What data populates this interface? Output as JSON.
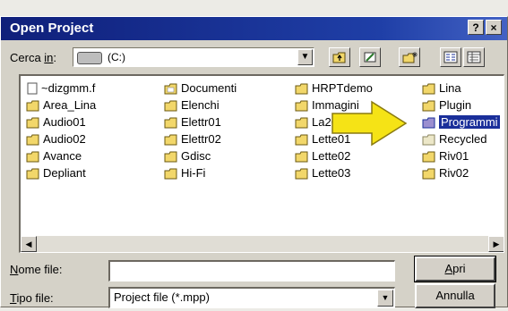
{
  "window": {
    "title": "Open Project",
    "help_label": "?",
    "close_label": "×"
  },
  "lookin": {
    "label_prefix": "Cerca ",
    "label_underlined": "in",
    "label_suffix": ":",
    "value": "(C:)",
    "drive_icon": "hard-drive-icon"
  },
  "toolbar": {
    "up_folder_icon": "up-folder-icon",
    "favorites_icon": "favorites-icon",
    "new_folder_icon": "new-folder-icon",
    "list_view_icon": "list-view-icon",
    "details_view_icon": "details-view-icon"
  },
  "files": {
    "columns": [
      [
        {
          "name": "~dizgmm.f",
          "type": "file"
        },
        {
          "name": "Area_Lina",
          "type": "folder"
        },
        {
          "name": "Audio01",
          "type": "folder"
        },
        {
          "name": "Audio02",
          "type": "folder"
        },
        {
          "name": "Avance",
          "type": "folder"
        },
        {
          "name": "Depliant",
          "type": "folder"
        }
      ],
      [
        {
          "name": "Documenti",
          "type": "folder-special"
        },
        {
          "name": "Elenchi",
          "type": "folder"
        },
        {
          "name": "Elettr01",
          "type": "folder"
        },
        {
          "name": "Elettr02",
          "type": "folder"
        },
        {
          "name": "Gdisc",
          "type": "folder"
        },
        {
          "name": "Hi-Fi",
          "type": "folder"
        }
      ],
      [
        {
          "name": "HRPTdemo",
          "type": "folder"
        },
        {
          "name": "Immagini",
          "type": "folder"
        },
        {
          "name": "La20",
          "type": "folder"
        },
        {
          "name": "Lette01",
          "type": "folder"
        },
        {
          "name": "Lette02",
          "type": "folder"
        },
        {
          "name": "Lette03",
          "type": "folder"
        }
      ],
      [
        {
          "name": "Lina",
          "type": "folder"
        },
        {
          "name": "Plugin",
          "type": "folder"
        },
        {
          "name": "Programmi",
          "type": "folder-selected"
        },
        {
          "name": "Recycled",
          "type": "folder-recycled"
        },
        {
          "name": "Riv01",
          "type": "folder"
        },
        {
          "name": "Riv02",
          "type": "folder"
        }
      ]
    ],
    "selected": "Programmi"
  },
  "filename": {
    "label_underlined": "N",
    "label_rest": "ome file:",
    "value": ""
  },
  "filetype": {
    "label_underlined": "T",
    "label_rest": "ipo file:",
    "value": "Project file (*.mpp)"
  },
  "buttons": {
    "open_underlined": "A",
    "open_rest": "pri",
    "cancel_label": "Annulla"
  },
  "colors": {
    "titlebar": "#0f1f7a",
    "folder": "#f2d76a",
    "selection": "#1a2f9a",
    "annotation_arrow": "#f5e316"
  }
}
